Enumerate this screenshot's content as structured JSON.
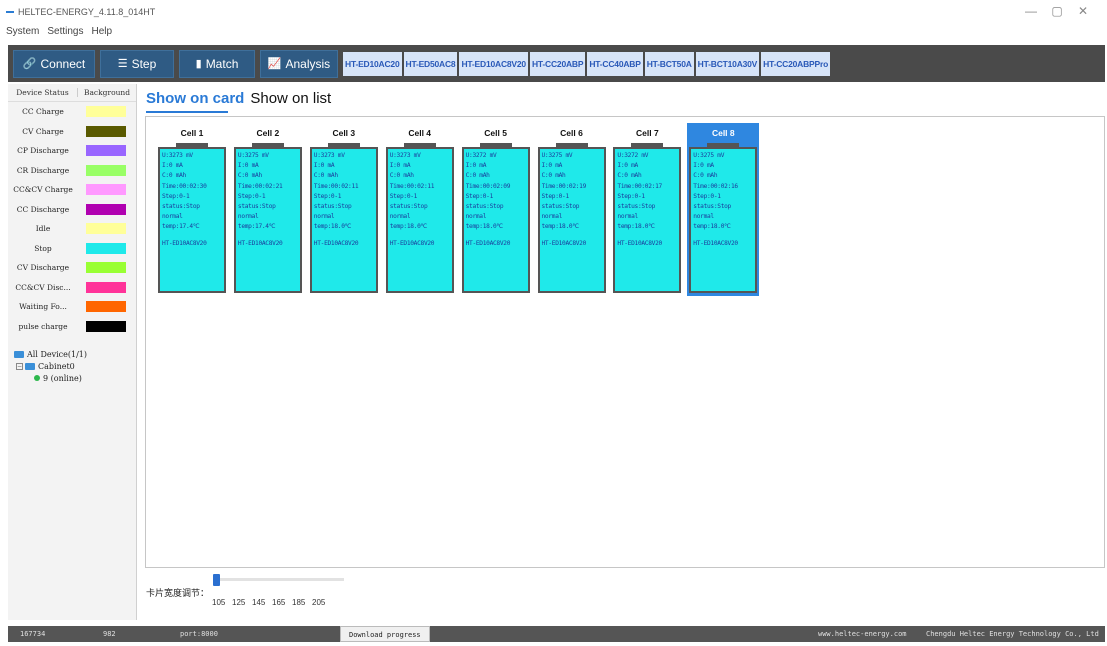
{
  "window": {
    "title": "HELTEC-ENERGY_4.11.8_014HT",
    "controls": [
      "—",
      "▢",
      "✕"
    ]
  },
  "menu": [
    "System",
    "Settings",
    "Help"
  ],
  "toolbar": {
    "connect": "Connect",
    "step": "Step",
    "match": "Match",
    "analysis": "Analysis",
    "models": [
      "HT-ED10AC20",
      "HT-ED50AC8",
      "HT-ED10AC8V20",
      "HT-CC20ABP",
      "HT-CC40ABP",
      "HT-BCT50A",
      "HT-BCT10A30V",
      "HT-CC20ABPPro"
    ]
  },
  "status_legend": {
    "header_status": "Device Status",
    "header_background": "Background",
    "items": [
      {
        "label": "CC Charge",
        "color": "#ffff99"
      },
      {
        "label": "CV Charge",
        "color": "#5a5a00"
      },
      {
        "label": "CP Discharge",
        "color": "#9966ff"
      },
      {
        "label": "CR Discharge",
        "color": "#99ff66"
      },
      {
        "label": "CC&CV Charge",
        "color": "#ff99ff"
      },
      {
        "label": "CC Discharge",
        "color": "#b000b0"
      },
      {
        "label": "Idle",
        "color": "#ffff99"
      },
      {
        "label": "Stop",
        "color": "#1fe9ea"
      },
      {
        "label": "CV Discharge",
        "color": "#99ff33"
      },
      {
        "label": "CC&CV Disc...",
        "color": "#ff3399"
      },
      {
        "label": "Waiting Fo...",
        "color": "#ff6600"
      },
      {
        "label": "pulse charge",
        "color": "#000000"
      }
    ]
  },
  "tree": {
    "root": "All Device(1/1)",
    "cabinet": "Cabinet0",
    "device": "9 (online)"
  },
  "view_tabs": {
    "card": "Show on card",
    "list": "Show on list"
  },
  "cells": [
    {
      "name": "Cell 1",
      "u": "U:3273 mV",
      "i": "I:0 mA",
      "c": "C:0 mAh",
      "time": "Time:00:02:30",
      "step": "Step:0-1",
      "status": "status:Stop",
      "state": "normal",
      "temp": "temp:17.4℃",
      "model": "HT-ED10AC8V20"
    },
    {
      "name": "Cell 2",
      "u": "U:3275 mV",
      "i": "I:0 mA",
      "c": "C:0 mAh",
      "time": "Time:00:02:21",
      "step": "Step:0-1",
      "status": "status:Stop",
      "state": "normal",
      "temp": "temp:17.4℃",
      "model": "HT-ED10AC8V20"
    },
    {
      "name": "Cell 3",
      "u": "U:3273 mV",
      "i": "I:0 mA",
      "c": "C:0 mAh",
      "time": "Time:00:02:11",
      "step": "Step:0-1",
      "status": "status:Stop",
      "state": "normal",
      "temp": "temp:18.0℃",
      "model": "HT-ED10AC8V20"
    },
    {
      "name": "Cell 4",
      "u": "U:3273 mV",
      "i": "I:0 mA",
      "c": "C:0 mAh",
      "time": "Time:00:02:11",
      "step": "Step:0-1",
      "status": "status:Stop",
      "state": "normal",
      "temp": "temp:18.0℃",
      "model": "HT-ED10AC8V20"
    },
    {
      "name": "Cell 5",
      "u": "U:3272 mV",
      "i": "I:0 mA",
      "c": "C:0 mAh",
      "time": "Time:00:02:09",
      "step": "Step:0-1",
      "status": "status:Stop",
      "state": "normal",
      "temp": "temp:18.0℃",
      "model": "HT-ED10AC8V20"
    },
    {
      "name": "Cell 6",
      "u": "U:3275 mV",
      "i": "I:0 mA",
      "c": "C:0 mAh",
      "time": "Time:00:02:19",
      "step": "Step:0-1",
      "status": "status:Stop",
      "state": "normal",
      "temp": "temp:18.0℃",
      "model": "HT-ED10AC8V20"
    },
    {
      "name": "Cell 7",
      "u": "U:3272 mV",
      "i": "I:0 mA",
      "c": "C:0 mAh",
      "time": "Time:00:02:17",
      "step": "Step:0-1",
      "status": "status:Stop",
      "state": "normal",
      "temp": "temp:18.0℃",
      "model": "HT-ED10AC8V20"
    },
    {
      "name": "Cell 8",
      "u": "U:3275 mV",
      "i": "I:0 mA",
      "c": "C:0 mAh",
      "time": "Time:00:02:16",
      "step": "Step:0-1",
      "status": "status:Stop",
      "state": "normal",
      "temp": "temp:18.0℃",
      "model": "HT-ED10AC8V20",
      "selected": true
    }
  ],
  "slider": {
    "label": "卡片宽度调节：",
    "value": 105,
    "ticks": [
      "105",
      "125",
      "145",
      "165",
      "185",
      "205"
    ]
  },
  "statusbar": {
    "left_value": "167734",
    "count": "982",
    "port": "port:8000",
    "download": "Download progress",
    "website": "www.heltec-energy.com",
    "company": "Chengdu Heltec Energy Technology Co., Ltd"
  }
}
